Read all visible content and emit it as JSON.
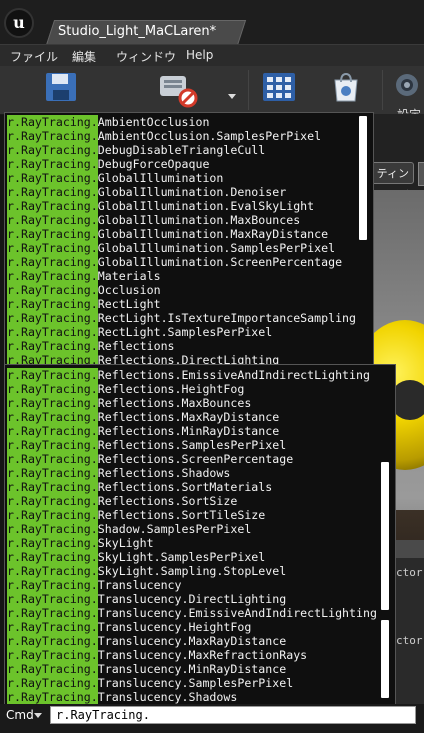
{
  "window": {
    "tab_title": "Studio_Light_MaCLaren*"
  },
  "menu": [
    "ファイル",
    "編集",
    "ウィンドウ",
    "Help"
  ],
  "toolbar": {
    "settings_label": "設定"
  },
  "viewport": {
    "mode_button": "ティング"
  },
  "lower_panel": {
    "text1": "ctor",
    "text2": "ctor"
  },
  "console": {
    "cmd_label": "Cmd",
    "input_value": "r.RayTracing.",
    "prefix": "r.RayTracing.",
    "list1": [
      "AmbientOcclusion",
      "AmbientOcclusion.SamplesPerPixel",
      "DebugDisableTriangleCull",
      "DebugForceOpaque",
      "GlobalIllumination",
      "GlobalIllumination.Denoiser",
      "GlobalIllumination.EvalSkyLight",
      "GlobalIllumination.MaxBounces",
      "GlobalIllumination.MaxRayDistance",
      "GlobalIllumination.SamplesPerPixel",
      "GlobalIllumination.ScreenPercentage",
      "Materials",
      "Occlusion",
      "RectLight",
      "RectLight.IsTextureImportanceSampling",
      "RectLight.SamplesPerPixel",
      "Reflections",
      "Reflections.DirectLighting"
    ],
    "list2": [
      "Reflections.EmissiveAndIndirectLighting",
      "Reflections.HeightFog",
      "Reflections.MaxBounces",
      "Reflections.MaxRayDistance",
      "Reflections.MinRayDistance",
      "Reflections.SamplesPerPixel",
      "Reflections.ScreenPercentage",
      "Reflections.Shadows",
      "Reflections.SortMaterials",
      "Reflections.SortSize",
      "Reflections.SortTileSize",
      "Shadow.SamplesPerPixel",
      "SkyLight",
      "SkyLight.SamplesPerPixel",
      "SkyLight.Sampling.StopLevel",
      "Translucency",
      "Translucency.DirectLighting",
      "Translucency.EmissiveAndIndirectLighting",
      "Translucency.HeightFog",
      "Translucency.MaxRayDistance",
      "Translucency.MaxRefractionRays",
      "Translucency.MinRayDistance",
      "Translucency.SamplesPerPixel",
      "Translucency.Shadows"
    ]
  },
  "colors": {
    "highlight": "#6cc32b",
    "panel_bg": "#0f0f0f"
  }
}
